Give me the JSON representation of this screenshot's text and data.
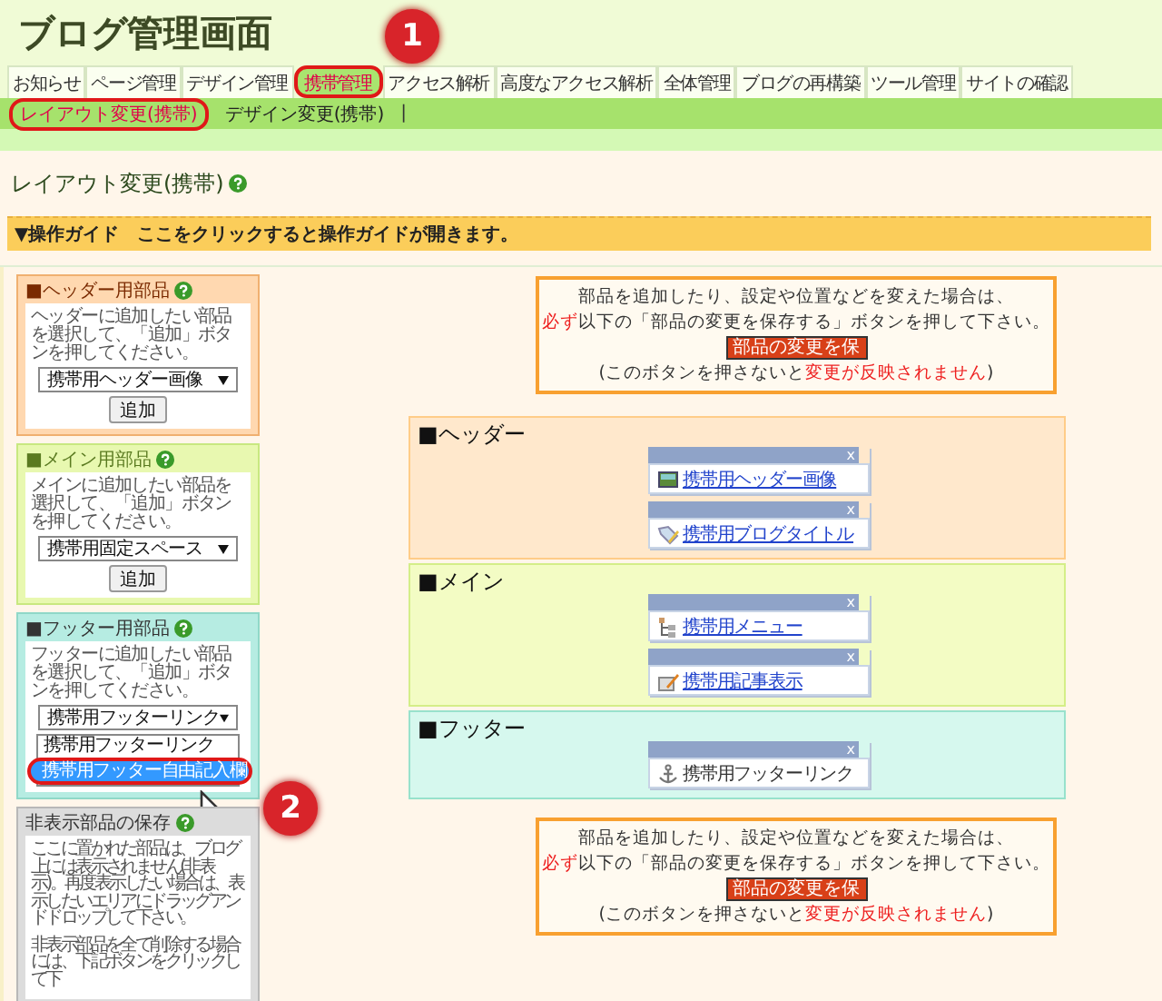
{
  "app_title": "ブログ管理画面",
  "tabs": [
    {
      "label": "お知らせ",
      "selected": false,
      "highlighted": false
    },
    {
      "label": "ページ管理",
      "selected": false,
      "highlighted": false
    },
    {
      "label": "デザイン管理",
      "selected": false,
      "highlighted": false
    },
    {
      "label": "携帯管理",
      "selected": true,
      "highlighted": true
    },
    {
      "label": "アクセス解析",
      "selected": false,
      "highlighted": false
    },
    {
      "label": "高度なアクセス解析",
      "selected": false,
      "highlighted": false
    },
    {
      "label": "全体管理",
      "selected": false,
      "highlighted": false
    },
    {
      "label": "ブログの再構築",
      "selected": false,
      "highlighted": false
    },
    {
      "label": "ツール管理",
      "selected": false,
      "highlighted": false
    },
    {
      "label": "サイトの確認",
      "selected": false,
      "highlighted": false
    }
  ],
  "subtabs": [
    {
      "label": "レイアウト変更(携帯)",
      "selected": true,
      "highlighted": true
    },
    {
      "label": "デザイン変更(携帯)",
      "selected": false,
      "highlighted": false
    }
  ],
  "subtab_separator": "|",
  "page_heading": "レイアウト変更(携帯)",
  "guide": "▼操作ガイド　ここをクリックすると操作ガイドが開きます。",
  "palettes": [
    {
      "kind": "header",
      "title": "■ヘッダー用部品",
      "help": "ヘッダーに追加したい部品を選択して、「追加」ボタンを押してください。",
      "select": "携帯用ヘッダー画像",
      "button": "追加"
    },
    {
      "kind": "main",
      "title": "■メイン用部品",
      "help": "メインに追加したい部品を選択して、「追加」ボタンを押してください。",
      "select": "携帯用固定スペース",
      "button": "追加"
    },
    {
      "kind": "footer",
      "title": "■フッター用部品",
      "help": "フッターに追加したい部品を選択して、「追加」ボタンを押してください。",
      "select": "携帯用フッターリンク",
      "options": [
        {
          "label": "携帯用フッターリンク",
          "selected": false,
          "highlighted": false
        },
        {
          "label": "携帯用フッター自由記入欄",
          "selected": true,
          "highlighted": true
        }
      ]
    },
    {
      "kind": "hidden",
      "title": "非表示部品の保存",
      "paragraphs": [
        "ここに置かれた部品は、ブログ上には表示されません(非表示)。再度表示したい場合は、表示したいエリアにドラッグアンドドロップして下さい。",
        "非表示部品を全て削除する場合には、下記ボタンをクリックして下"
      ]
    }
  ],
  "notices": [
    {
      "lines": [
        [
          {
            "text": "部品を追加したり、設定や位置などを変えた場合は、",
            "emphasis": false
          }
        ],
        [
          {
            "text": "必ず",
            "emphasis": true
          },
          {
            "text": "以下の「部品の変更を保存する」ボタンを押して下さい。",
            "emphasis": false
          }
        ]
      ],
      "button": "部品の変更を保",
      "footer": [
        {
          "text": "(このボタンを押さないと",
          "emphasis": false
        },
        {
          "text": "変更が反映されません",
          "emphasis": true
        },
        {
          "text": ")",
          "emphasis": false
        }
      ]
    },
    {
      "lines": [
        [
          {
            "text": "部品を追加したり、設定や位置などを変えた場合は、",
            "emphasis": false
          }
        ],
        [
          {
            "text": "必ず",
            "emphasis": true
          },
          {
            "text": "以下の「部品の変更を保存する」ボタンを押して下さい。",
            "emphasis": false
          }
        ]
      ],
      "button": "部品の変更を保",
      "footer": [
        {
          "text": "(このボタンを押さないと",
          "emphasis": false
        },
        {
          "text": "変更が反映されません",
          "emphasis": true
        },
        {
          "text": ")",
          "emphasis": false
        }
      ]
    }
  ],
  "zones": [
    {
      "kind": "header",
      "title": "■ヘッダー",
      "parts": [
        {
          "kind": "image",
          "label": "携帯用ヘッダー画像",
          "linked": true,
          "close": "x"
        },
        {
          "kind": "tag",
          "label": "携帯用ブログタイトル",
          "linked": true,
          "close": "x"
        }
      ]
    },
    {
      "kind": "main",
      "title": "■メイン",
      "parts": [
        {
          "kind": "tree",
          "label": "携帯用メニュー",
          "linked": true,
          "close": "x"
        },
        {
          "kind": "pencil",
          "label": "携帯用記事表示",
          "linked": true,
          "close": "x"
        }
      ]
    },
    {
      "kind": "footer",
      "title": "■フッター",
      "parts": [
        {
          "kind": "anchor",
          "label": "携帯用フッターリンク",
          "linked": false,
          "close": "x"
        }
      ]
    }
  ],
  "callouts": [
    "1",
    "2"
  ]
}
